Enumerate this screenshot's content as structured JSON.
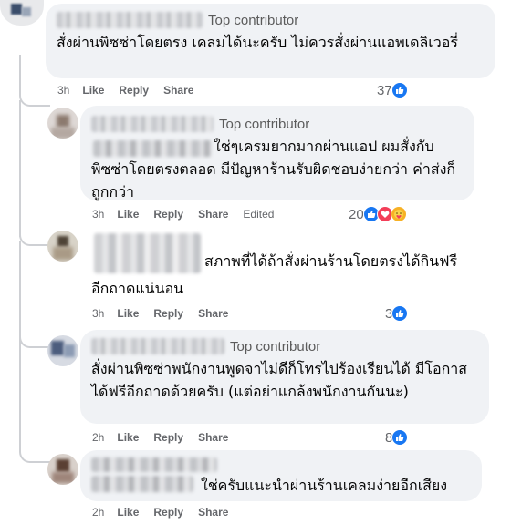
{
  "comments": [
    {
      "badge": "Top contributor",
      "text": "สั่งผ่านพิซซ่าโดยตรง เคลมได้นะครับ ไม่ควรสั่งผ่านแอพเดลิเวอรี่",
      "time": "3h",
      "like": "Like",
      "reply": "Reply",
      "share": "Share",
      "reaction_count": "37",
      "reactions": [
        "like-icon"
      ]
    },
    {
      "badge": "Top contributor",
      "text": "ใช่ๆเครมยากมากผ่านแอป ผมสั่งกับพิซซ่าโดยตรงตลอด มีปัญหาร้านรับผิดชอบง่ายกว่า ค่าส่งก็ถูกกว่า",
      "time": "3h",
      "like": "Like",
      "reply": "Reply",
      "share": "Share",
      "edited": "Edited",
      "reaction_count": "20",
      "reactions": [
        "like-icon",
        "love-icon",
        "care-icon"
      ]
    },
    {
      "text": "สภาพที่ได้ถ้าสั่งผ่านร้านโดยตรงได้กินฟรีอีกถาดแน่นอน",
      "time": "3h",
      "like": "Like",
      "reply": "Reply",
      "share": "Share",
      "reaction_count": "3",
      "reactions": [
        "like-icon"
      ]
    },
    {
      "badge": "Top contributor",
      "text": "สั่งผ่านพิซซ่าพนักงานพูดจาไม่ดีก็โทรไปร้องเรียนได้ มีโอกาสได้ฟรีอีกถาดด้วยครับ (แต่อย่าแกล้งพนักงานกันนะ)",
      "time": "2h",
      "like": "Like",
      "reply": "Reply",
      "share": "Share",
      "reaction_count": "8",
      "reactions": [
        "like-icon"
      ]
    },
    {
      "text": "ใช่ครับแนะนำผ่านร้านเคลมง่ายอีกเสียง",
      "time": "2h",
      "like": "Like",
      "reply": "Reply",
      "share": "Share"
    }
  ],
  "colors": {
    "like": "#1877f2",
    "love": "#f33e58",
    "care": "#f7b125",
    "bubble": "#f0f2f5",
    "meta": "#65676b"
  }
}
